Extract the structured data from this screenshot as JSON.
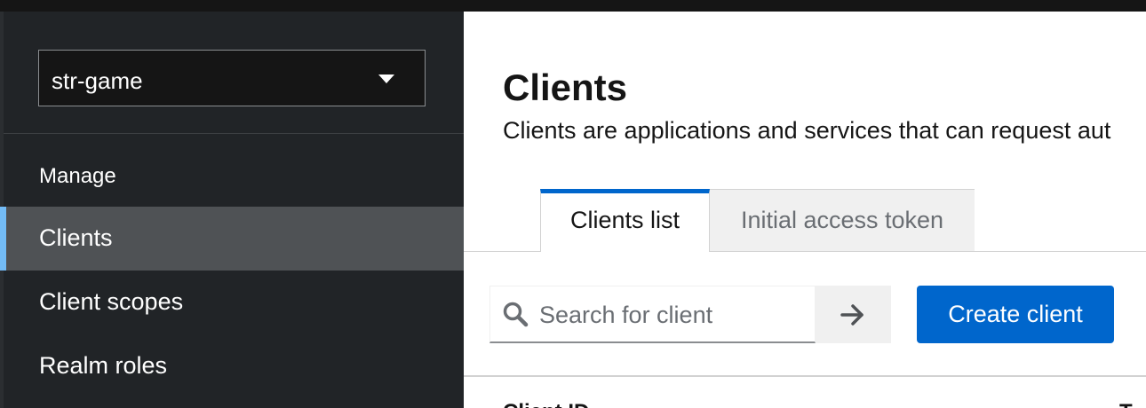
{
  "realm_selector": {
    "value": "str-game"
  },
  "sidebar": {
    "section_label": "Manage",
    "items": [
      {
        "label": "Clients",
        "active": true
      },
      {
        "label": "Client scopes",
        "active": false
      },
      {
        "label": "Realm roles",
        "active": false
      }
    ]
  },
  "page": {
    "title": "Clients",
    "description": "Clients are applications and services that can request aut"
  },
  "tabs": [
    {
      "label": "Clients list",
      "active": true
    },
    {
      "label": "Initial access token",
      "active": false
    }
  ],
  "toolbar": {
    "search_placeholder": "Search for client",
    "create_label": "Create client"
  },
  "table": {
    "columns": [
      "Client ID",
      "T"
    ]
  },
  "colors": {
    "sidebar_bg": "#212427",
    "active_nav_bg": "#4f5255",
    "active_nav_accent": "#73bcf7",
    "primary": "#0066cc"
  },
  "icons": {
    "realm_caret": "caret-down-icon",
    "search": "search-icon",
    "search_go": "arrow-right-icon"
  }
}
